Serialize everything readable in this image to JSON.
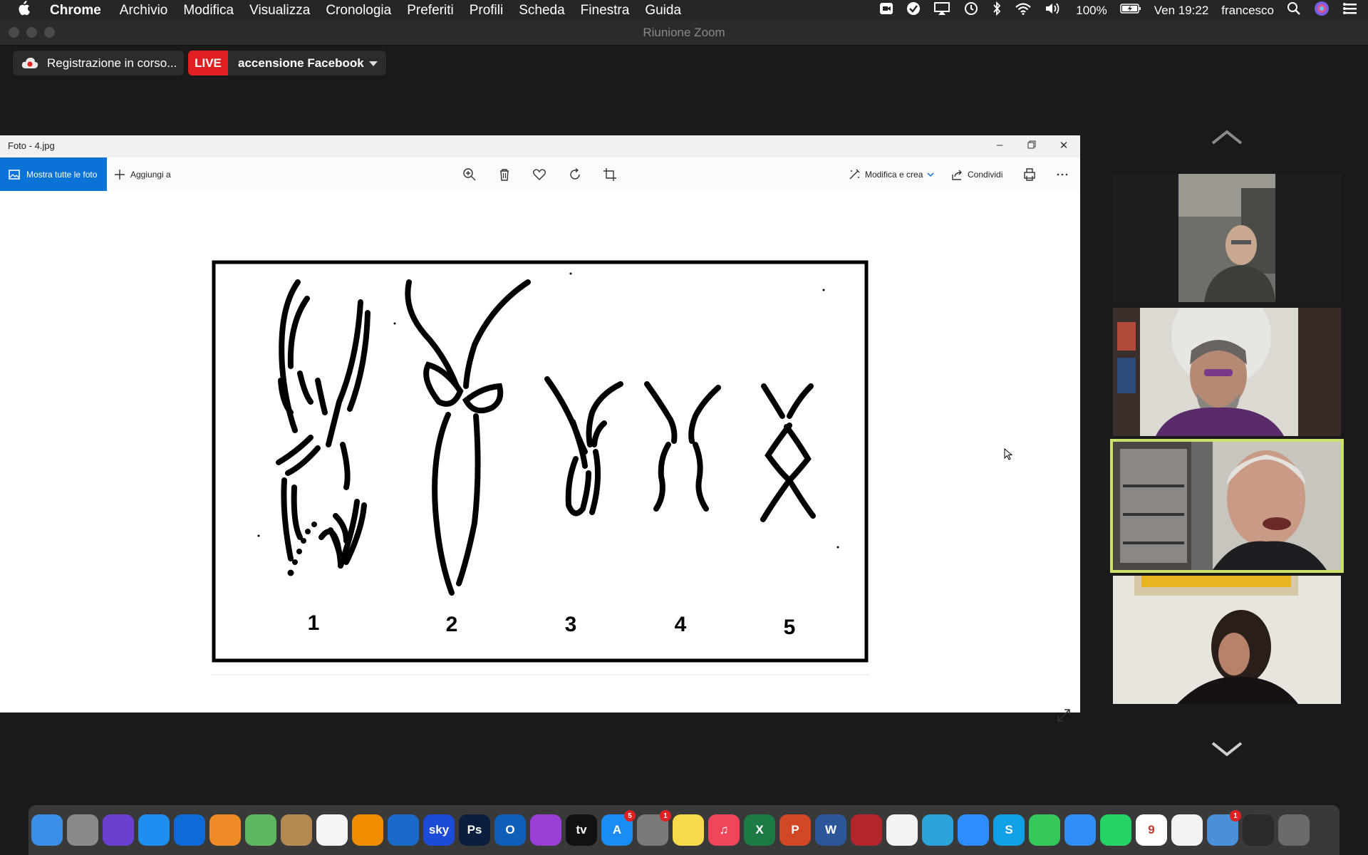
{
  "menubar": {
    "app_name": "Chrome",
    "items": [
      "Archivio",
      "Modifica",
      "Visualizza",
      "Cronologia",
      "Preferiti",
      "Profili",
      "Scheda",
      "Finestra",
      "Guida"
    ],
    "battery": "100%",
    "clock": "Ven 19:22",
    "user": "francesco"
  },
  "zoom": {
    "window_title": "Riunione Zoom",
    "recording_label": "Registrazione in corso...",
    "live_badge": "LIVE",
    "live_name": "accensione Facebook"
  },
  "viewer": {
    "title": "Foto - 4.jpg",
    "show_all_label": "Mostra tutte le foto",
    "add_to_label": "Aggiungi a",
    "edit_create_label": "Modifica e crea",
    "share_label": "Condividi",
    "figure_numbers": [
      "1",
      "2",
      "3",
      "4",
      "5"
    ]
  },
  "dock": {
    "items": [
      {
        "name": "finder",
        "label": "",
        "color": "#3a8ee6"
      },
      {
        "name": "launchpad",
        "label": "",
        "color": "#8a8a8a"
      },
      {
        "name": "siri",
        "label": "",
        "color": "#6b3fd0"
      },
      {
        "name": "safari",
        "label": "",
        "color": "#1f8ef1"
      },
      {
        "name": "teamviewer",
        "label": "",
        "color": "#0e6ad7"
      },
      {
        "name": "books",
        "label": "",
        "color": "#f08a24"
      },
      {
        "name": "maps",
        "label": "",
        "color": "#5fb85f"
      },
      {
        "name": "contacts",
        "label": "",
        "color": "#b58a52"
      },
      {
        "name": "reminders",
        "label": "",
        "color": "#f5f5f5"
      },
      {
        "name": "vlc",
        "label": "",
        "color": "#f08c00"
      },
      {
        "name": "edge",
        "label": "",
        "color": "#1b6ac9"
      },
      {
        "name": "skygo",
        "label": "sky",
        "color": "#1c4bd8"
      },
      {
        "name": "photoshop",
        "label": "Ps",
        "color": "#0b1e3d"
      },
      {
        "name": "outlook",
        "label": "O",
        "color": "#0f5fb8"
      },
      {
        "name": "podcasts",
        "label": "",
        "color": "#9b3ed6"
      },
      {
        "name": "appletv",
        "label": "tv",
        "color": "#111111"
      },
      {
        "name": "appstore",
        "label": "A",
        "color": "#1a8cf5",
        "badge": "5"
      },
      {
        "name": "system-preferences",
        "label": "",
        "color": "#7a7a7a",
        "badge": "1"
      },
      {
        "name": "notes",
        "label": "",
        "color": "#f7d94c"
      },
      {
        "name": "music",
        "label": "♫",
        "color": "#f0455b"
      },
      {
        "name": "excel",
        "label": "X",
        "color": "#1d7a45"
      },
      {
        "name": "powerpoint",
        "label": "P",
        "color": "#d24726"
      },
      {
        "name": "word",
        "label": "W",
        "color": "#2b579a"
      },
      {
        "name": "photo-booth",
        "label": "",
        "color": "#b3262c"
      },
      {
        "name": "photos",
        "label": "",
        "color": "#f2f2f2"
      },
      {
        "name": "facetime-like",
        "label": "",
        "color": "#2aa3d9"
      },
      {
        "name": "zoom",
        "label": "",
        "color": "#2d8cff"
      },
      {
        "name": "skype",
        "label": "S",
        "color": "#0fa0e5"
      },
      {
        "name": "facetime",
        "label": "",
        "color": "#34c759"
      },
      {
        "name": "messages",
        "label": "",
        "color": "#2f8df5"
      },
      {
        "name": "whatsapp",
        "label": "",
        "color": "#25d366"
      },
      {
        "name": "calendar",
        "label": "9",
        "color": "#ffffff"
      },
      {
        "name": "chrome",
        "label": "",
        "color": "#f2f2f2"
      },
      {
        "name": "preview",
        "label": "",
        "color": "#4a90d9",
        "badge": "1"
      },
      {
        "name": "screenshot",
        "label": "",
        "color": "#2a2a2a"
      },
      {
        "name": "trash",
        "label": "",
        "color": "#6a6a6a"
      }
    ]
  }
}
